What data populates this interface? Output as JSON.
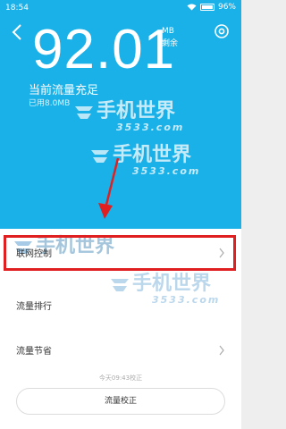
{
  "status_bar": {
    "time": "18:54",
    "battery": "96%"
  },
  "header": {
    "remaining_value": "92.01",
    "unit": "MB",
    "remaining_label": "剩余",
    "status_title": "当前流量充足",
    "used_text": "已用8.0MB"
  },
  "watermark": {
    "main": "手机世界",
    "sub": "3533.com"
  },
  "list": {
    "items": [
      {
        "label": "联网控制"
      },
      {
        "label": "流量排行"
      },
      {
        "label": "流量节省"
      }
    ]
  },
  "footer": {
    "calibrated_time": "今天09:43校正",
    "calibrate_button": "流量校正"
  },
  "colors": {
    "header_bg": "#1ab0e8",
    "highlight": "#e02020"
  }
}
